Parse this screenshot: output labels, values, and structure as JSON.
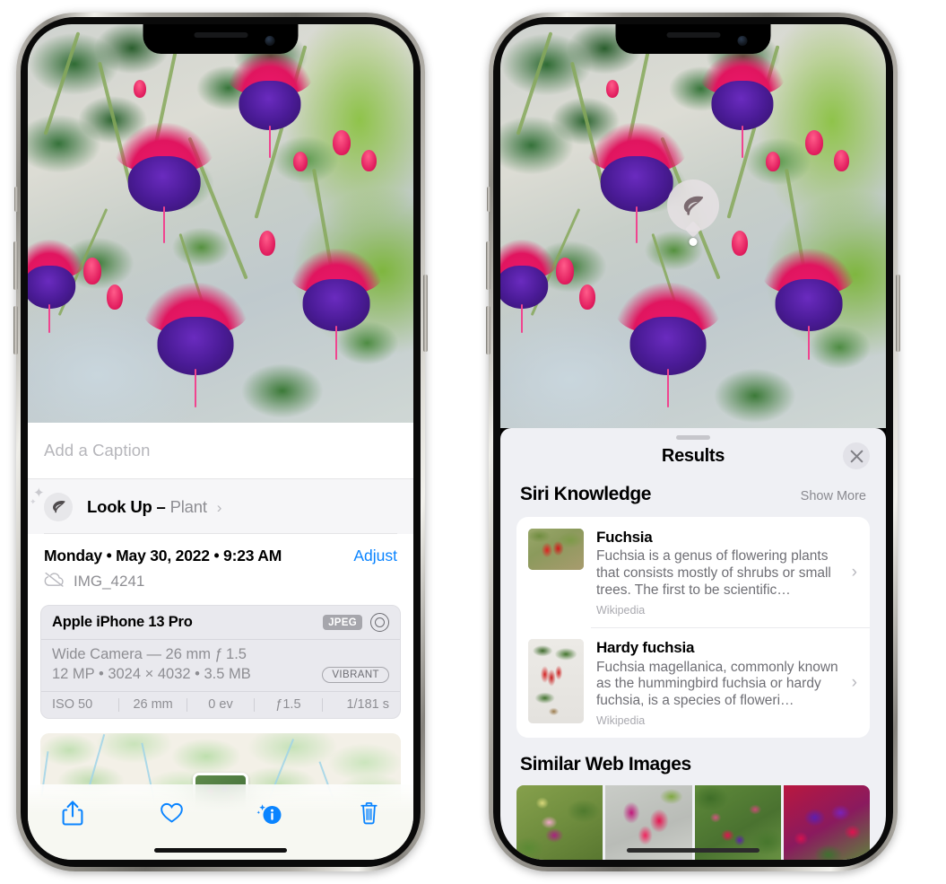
{
  "left_phone": {
    "photo_alt": "fuchsia-plant-photo",
    "caption": {
      "placeholder": "Add a Caption",
      "value": ""
    },
    "look_up": {
      "icon": "leaf-icon",
      "label": "Look Up",
      "dash": "–",
      "subject": "Plant",
      "chevron": "›"
    },
    "meta": {
      "date": "Monday • May 30, 2022 • 9:23 AM",
      "adjust_label": "Adjust",
      "cloud_icon": "cloud-slash-icon",
      "filename": "IMG_4241"
    },
    "camera_card": {
      "device": "Apple iPhone 13 Pro",
      "format_badge": "JPEG",
      "raw_icon": "raw-circle-icon",
      "lens_line": "Wide Camera — 26 mm ƒ 1.5",
      "specs_line": "12 MP • 3024 × 4032 • 3.5 MB",
      "style_badge": "VIBRANT",
      "exif": [
        "ISO 50",
        "26 mm",
        "0 ev",
        "ƒ1.5",
        "1/181 s"
      ]
    },
    "map": {
      "thumbnail": "photo-location-thumbnail"
    },
    "toolbar": [
      {
        "name": "share-button",
        "icon": "share-icon"
      },
      {
        "name": "favorite-button",
        "icon": "heart-icon"
      },
      {
        "name": "info-button",
        "icon": "info-sparkle-icon"
      },
      {
        "name": "delete-button",
        "icon": "trash-icon"
      }
    ]
  },
  "right_phone": {
    "photo_alt": "fuchsia-plant-photo",
    "visual_lookup_badge": {
      "icon": "leaf-icon"
    },
    "sheet": {
      "grabber": "sheet-grabber",
      "title": "Results",
      "close_icon": "close-icon",
      "siri_knowledge": {
        "title": "Siri Knowledge",
        "action": "Show More",
        "cards": [
          {
            "title": "Fuchsia",
            "description": "Fuchsia is a genus of flowering plants that consists mostly of shrubs or small trees. The first to be scientific…",
            "source": "Wikipedia",
            "chevron": "›",
            "thumbnail": "fuchsia-flowers-thumbnail"
          },
          {
            "title": "Hardy fuchsia",
            "description": "Fuchsia magellanica, commonly known as the hummingbird fuchsia or hardy fuchsia, is a species of floweri…",
            "source": "Wikipedia",
            "chevron": "›",
            "thumbnail": "hardy-fuchsia-thumbnail"
          }
        ]
      },
      "similar_web_images": {
        "title": "Similar Web Images",
        "tiles": [
          "similar-image-1",
          "similar-image-2",
          "similar-image-3",
          "similar-image-4"
        ]
      }
    }
  },
  "colors": {
    "accent_blue": "#0A84FF",
    "sheet_bg": "#EFF0F4",
    "card_bg": "#FFFFFF",
    "secondary_text": "#8E8E93",
    "camera_card_bg": "#E9E9EE"
  }
}
